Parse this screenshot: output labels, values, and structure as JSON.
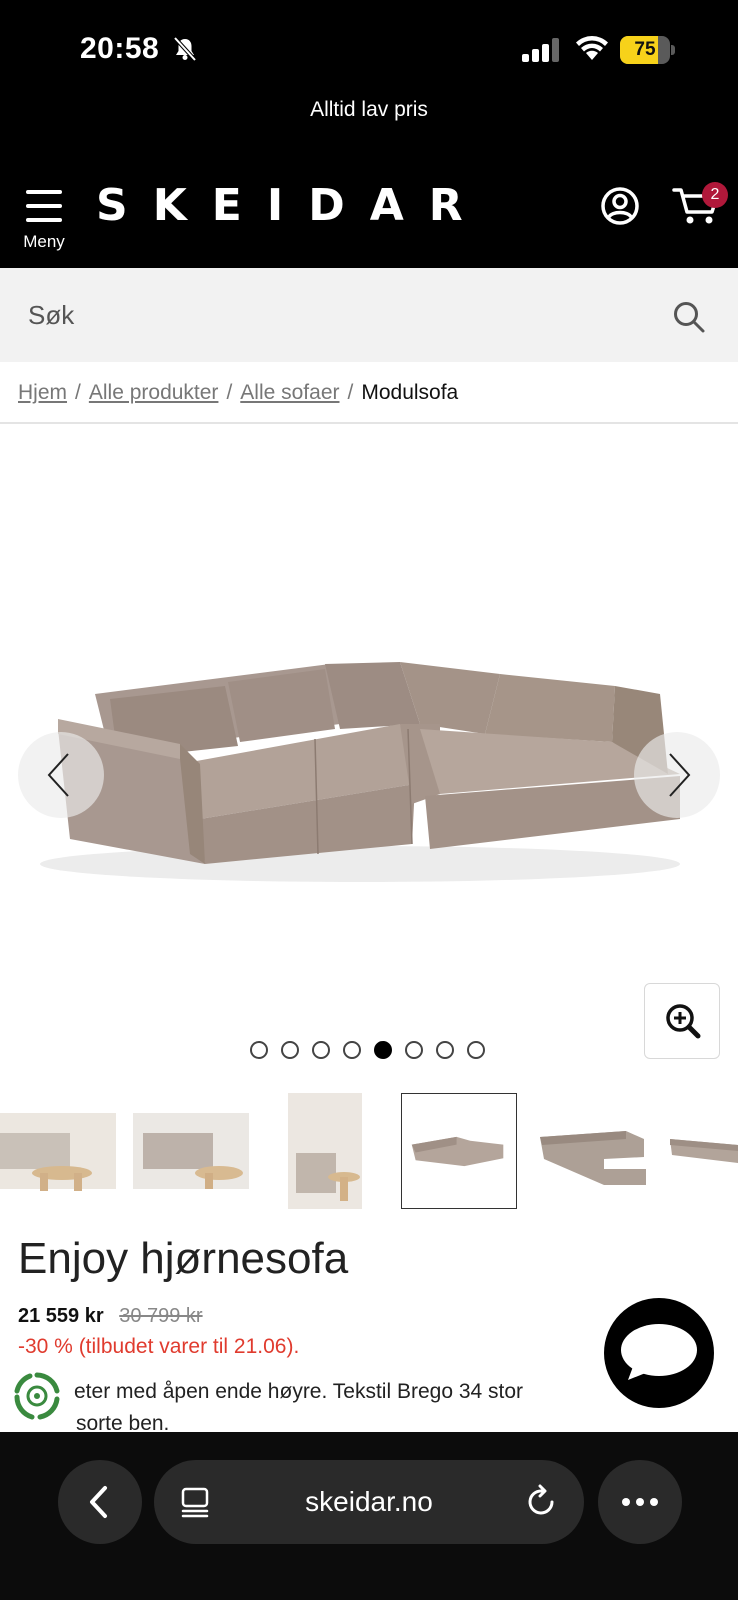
{
  "status_bar": {
    "time": "20:58",
    "battery": "75",
    "battery_level": 0.75,
    "battery_color": "#f7d21a"
  },
  "promo": {
    "text": "Alltid lav pris"
  },
  "header": {
    "menu_label": "Meny",
    "logo": "SKEIDAR",
    "cart_count": "2",
    "badge_color": "#b0183a"
  },
  "search": {
    "placeholder": "Søk"
  },
  "breadcrumb": {
    "items": [
      "Hjem",
      "Alle produkter",
      "Alle sofaer"
    ],
    "current": "Modulsofa",
    "separator": "/"
  },
  "gallery": {
    "image_count": 8,
    "active_index": 4,
    "active_thumb_index": 3,
    "thumbnail_count": 6
  },
  "product": {
    "title": "Enjoy hjørnesofa",
    "price": "21 559 kr",
    "old_price": "30 799 kr",
    "discount": "-30 % (tilbudet varer til 21.06).",
    "discount_color": "#e03b2e",
    "description_line1": "eter med åpen ende høyre. Tekstil Brego 34 stor",
    "description_line2": "sorte ben."
  },
  "browser": {
    "url": "skeidar.no"
  }
}
